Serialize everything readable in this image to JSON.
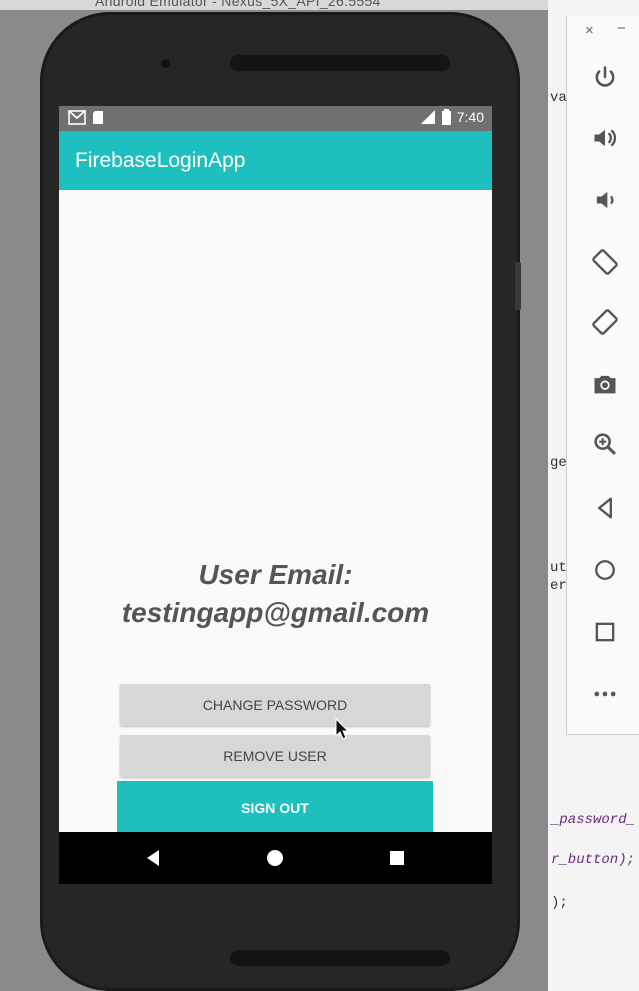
{
  "window": {
    "title": "Android Emulator - Nexus_5X_API_26:5554"
  },
  "ide": {
    "code_fragments": [
      "va",
      "ge",
      "ut",
      "er",
      "_password_",
      "r_button);",
      ");"
    ]
  },
  "emulator_toolbar": {
    "close_label": "×",
    "minimize_label": "−",
    "buttons": [
      "power-icon",
      "volume-up-icon",
      "volume-down-icon",
      "rotate-left-icon",
      "rotate-right-icon",
      "camera-icon",
      "zoom-icon",
      "back-icon",
      "home-icon",
      "overview-icon",
      "more-icon"
    ]
  },
  "status_bar": {
    "time": "7:40"
  },
  "app_bar": {
    "title": "FirebaseLoginApp"
  },
  "main": {
    "email_label": "User Email:",
    "email_value": "testingapp@gmail.com",
    "change_password_label": "CHANGE PASSWORD",
    "remove_user_label": "REMOVE USER",
    "sign_out_label": "SIGN OUT"
  },
  "colors": {
    "accent": "#1ebfbf",
    "button_gray": "#d7d7d7"
  }
}
